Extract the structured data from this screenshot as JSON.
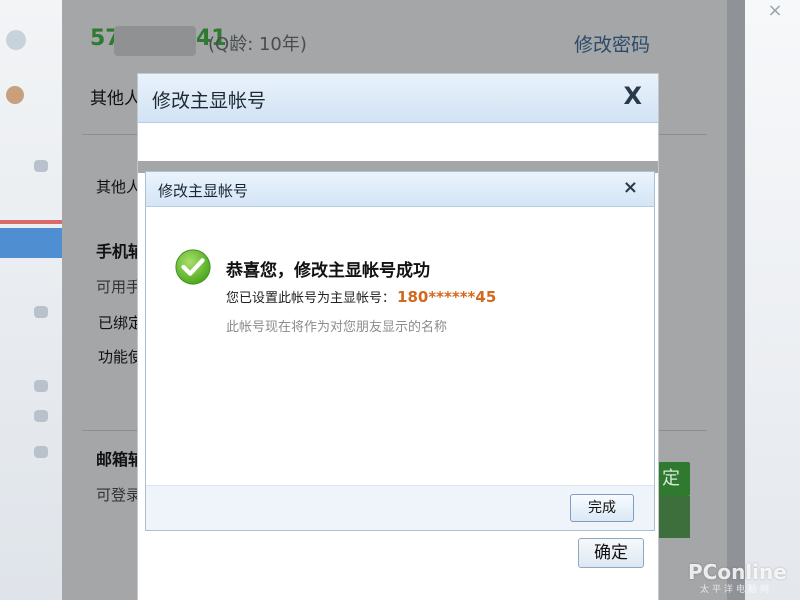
{
  "settings": {
    "account_prefix": "57",
    "account_suffix": "41",
    "q_age": "(Q龄: 10年)",
    "change_password": "修改密码",
    "rows": [
      {
        "text": "其他人"
      },
      {
        "text": "其他人"
      },
      {
        "text": "手机辅"
      },
      {
        "text": "可用手"
      },
      {
        "text": "已绑定"
      },
      {
        "text": "功能使"
      },
      {
        "text": "邮箱辅"
      },
      {
        "text": "可登录"
      }
    ],
    "green_button_label": "定"
  },
  "dialog_back": {
    "title": "修改主显帐号",
    "close": "X",
    "confirm_label": "确定"
  },
  "dialog_front": {
    "title": "修改主显帐号",
    "close": "×",
    "success_title": "恭喜您，修改主显帐号成功",
    "info_prefix": "您已设置此帐号为主显帐号：",
    "masked_account": "180******45",
    "note": "此帐号现在将作为对您朋友显示的名称",
    "done_label": "完成"
  },
  "window": {
    "close": "×"
  },
  "watermark": {
    "brand": "PConline",
    "sub": "太平洋电脑网"
  },
  "colors": {
    "success_green": "#5cb82e",
    "account_orange": "#d2691e",
    "qq_green": "#2e7a2e"
  }
}
